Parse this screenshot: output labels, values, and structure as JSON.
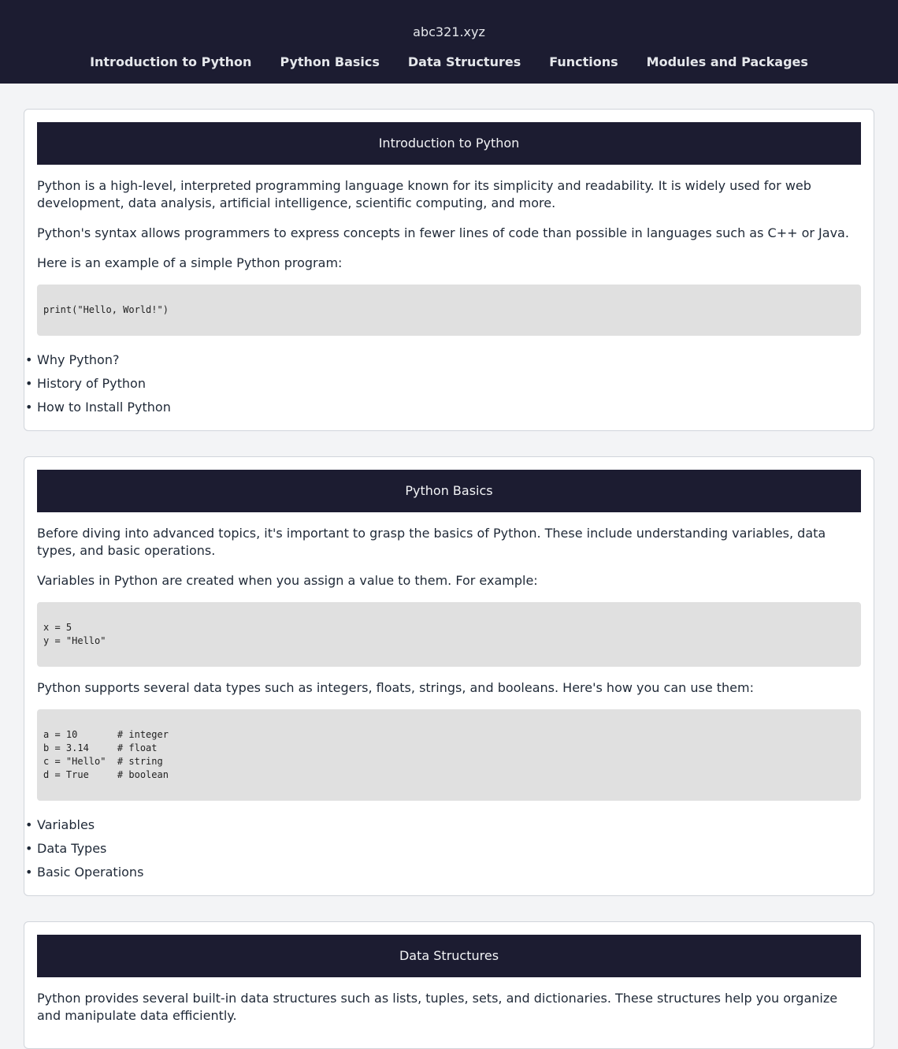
{
  "site": {
    "title": "abc321.xyz"
  },
  "nav": {
    "items": [
      "Introduction to Python",
      "Python Basics",
      "Data Structures",
      "Functions",
      "Modules and Packages"
    ]
  },
  "sections": [
    {
      "title": "Introduction to Python",
      "p1": "Python is a high-level, interpreted programming language known for its simplicity and readability. It is widely used for web development, data analysis, artificial intelligence, scientific computing, and more.",
      "p2": "Python's syntax allows programmers to express concepts in fewer lines of code than possible in languages such as C++ or Java.",
      "p3": "Here is an example of a simple Python program:",
      "code1": "print(\"Hello, World!\")",
      "links": [
        "Why Python?",
        "History of Python",
        "How to Install Python"
      ]
    },
    {
      "title": "Python Basics",
      "p1": "Before diving into advanced topics, it's important to grasp the basics of Python. These include understanding variables, data types, and basic operations.",
      "p2": "Variables in Python are created when you assign a value to them. For example:",
      "code1": "x = 5\ny = \"Hello\"",
      "p3": "Python supports several data types such as integers, floats, strings, and booleans. Here's how you can use them:",
      "code2": "a = 10       # integer\nb = 3.14     # float\nc = \"Hello\"  # string\nd = True     # boolean",
      "links": [
        "Variables",
        "Data Types",
        "Basic Operations"
      ]
    },
    {
      "title": "Data Structures",
      "p1": "Python provides several built-in data structures such as lists, tuples, sets, and dictionaries. These structures help you organize and manipulate data efficiently."
    }
  ]
}
